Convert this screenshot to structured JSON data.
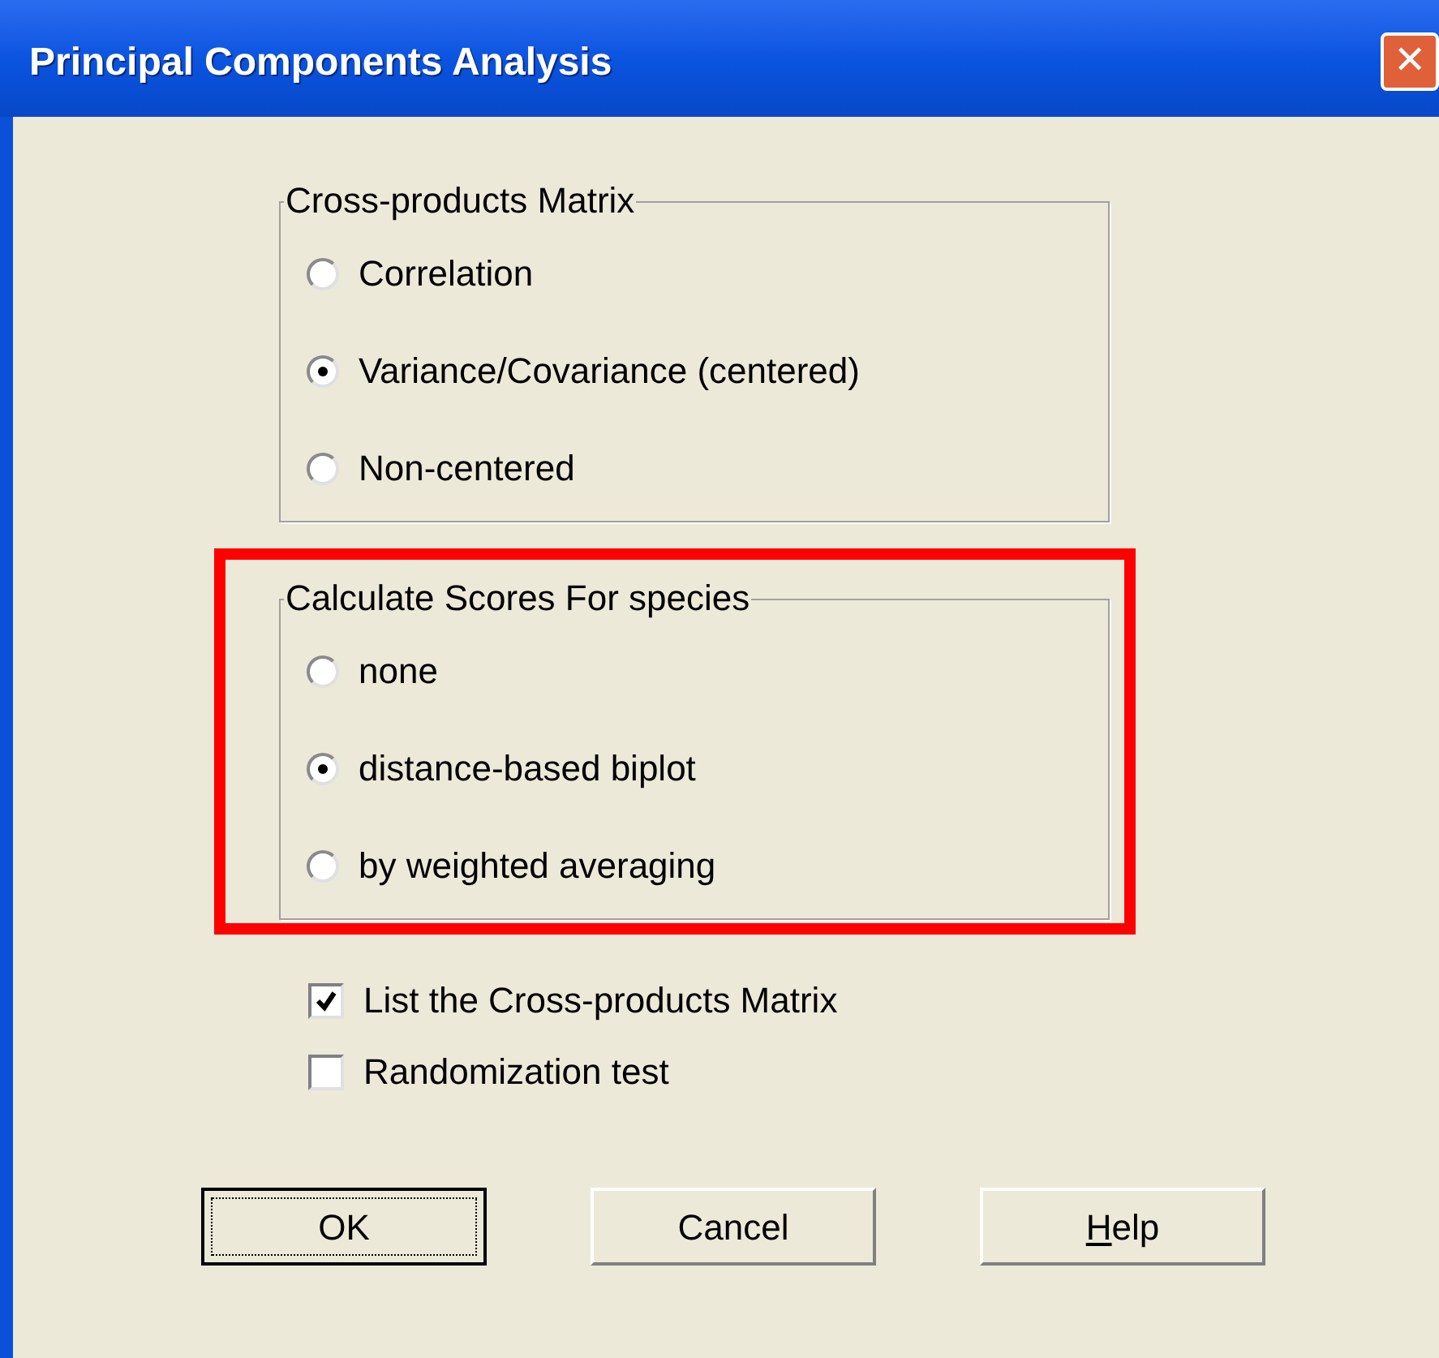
{
  "window": {
    "title": "Principal Components Analysis",
    "close_glyph": "✕"
  },
  "groups": [
    {
      "title": "Cross-products Matrix",
      "highlighted": false,
      "options": [
        {
          "label": "Correlation",
          "selected": false
        },
        {
          "label": "Variance/Covariance (centered)",
          "selected": true
        },
        {
          "label": "Non-centered",
          "selected": false
        }
      ]
    },
    {
      "title": "Calculate Scores For species",
      "highlighted": true,
      "options": [
        {
          "label": "none",
          "selected": false
        },
        {
          "label": "distance-based biplot",
          "selected": true
        },
        {
          "label": "by weighted averaging",
          "selected": false
        }
      ]
    }
  ],
  "checkboxes": [
    {
      "label": "List the Cross-products Matrix",
      "checked": true
    },
    {
      "label": "Randomization test",
      "checked": false
    }
  ],
  "buttons": [
    {
      "label": "OK",
      "default": true
    },
    {
      "label": "Cancel",
      "default": false
    },
    {
      "access_key": "H",
      "label": "elp",
      "default": false
    }
  ]
}
